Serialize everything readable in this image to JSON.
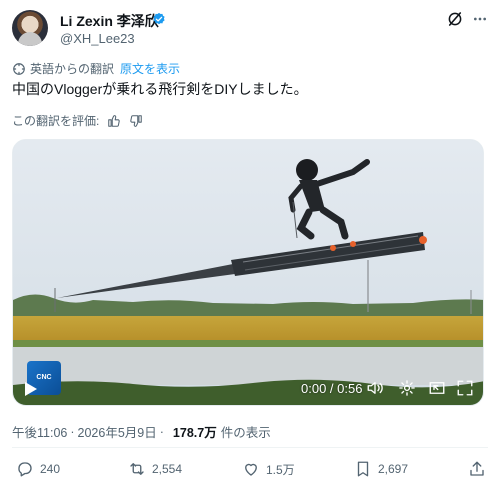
{
  "author": {
    "name": "Li Zexin 李泽欣",
    "handle": "@XH_Lee23",
    "avatar_icon": "profile-photo",
    "verified_color": "#1d9bf0"
  },
  "translation": {
    "notice": "英語からの翻訳",
    "show_original": "原文を表示",
    "rate_label": "この翻訳を評価:"
  },
  "tweet": {
    "text": "中国のVloggerが乗れる飛行剣をDIYしました。"
  },
  "media": {
    "logo_text": "CNC",
    "time": "0:00 / 0:56",
    "controls": [
      "play-icon",
      "volume-icon",
      "gear-icon",
      "pip-icon",
      "fullscreen-icon"
    ]
  },
  "meta": {
    "time": "午後11:06",
    "dot": "·",
    "date": "2026年5月9日",
    "views_count": "178.7万",
    "views_label": "件の表示"
  },
  "actions": {
    "replies": "240",
    "reposts": "2,554",
    "likes": "1.5万",
    "bookmarks": "2,697"
  },
  "colors": {
    "text": "#0f1419",
    "muted": "#536471",
    "accent": "#1d9bf0"
  }
}
